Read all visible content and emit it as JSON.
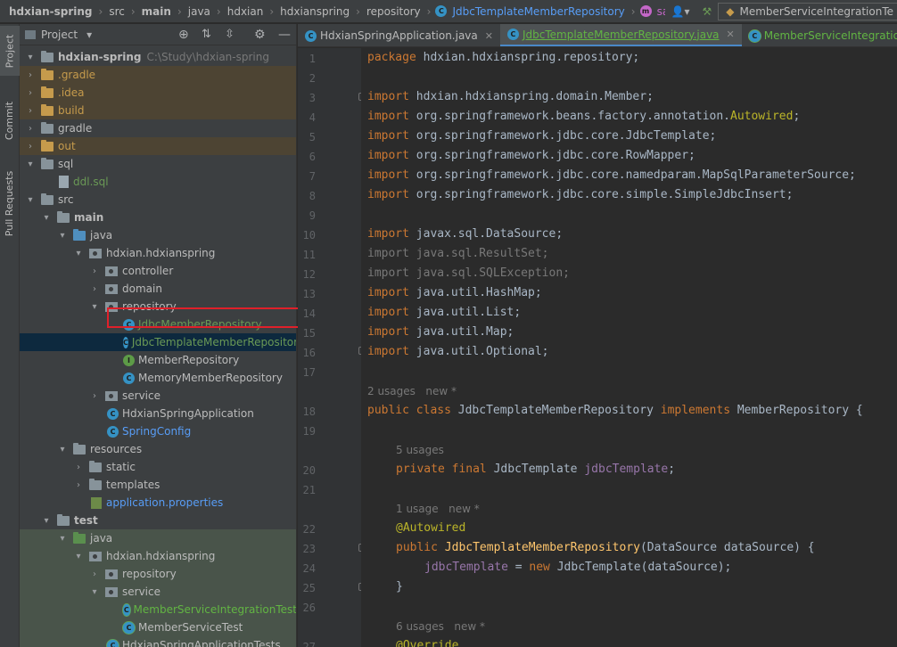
{
  "breadcrumb": {
    "items": [
      "hdxian-spring",
      "src",
      "main",
      "java",
      "hdxian",
      "hdxianspring",
      "repository",
      "JdbcTemplateMemberRepository",
      "save"
    ]
  },
  "toolbar": {
    "run_config": "MemberServiceIntegrationTe"
  },
  "rail": {
    "tabs": [
      "Project",
      "Commit",
      "Pull Requests"
    ]
  },
  "project_panel": {
    "title": "Project",
    "rows": [
      {
        "label": "hdxian-spring",
        "hint": "C:\\Study\\hdxian-spring"
      },
      {
        "label": ".gradle"
      },
      {
        "label": ".idea"
      },
      {
        "label": "build"
      },
      {
        "label": "gradle"
      },
      {
        "label": "out"
      },
      {
        "label": "sql"
      },
      {
        "label": "ddl.sql"
      },
      {
        "label": "src"
      },
      {
        "label": "main"
      },
      {
        "label": "java"
      },
      {
        "label": "hdxian.hdxianspring"
      },
      {
        "label": "controller"
      },
      {
        "label": "domain"
      },
      {
        "label": "repository"
      },
      {
        "label": "JdbcMemberRepository"
      },
      {
        "label": "JdbcTemplateMemberRepository"
      },
      {
        "label": "MemberRepository"
      },
      {
        "label": "MemoryMemberRepository"
      },
      {
        "label": "service"
      },
      {
        "label": "HdxianSpringApplication"
      },
      {
        "label": "SpringConfig"
      },
      {
        "label": "resources"
      },
      {
        "label": "static"
      },
      {
        "label": "templates"
      },
      {
        "label": "application.properties"
      },
      {
        "label": "test"
      },
      {
        "label": "java"
      },
      {
        "label": "hdxian.hdxianspring"
      },
      {
        "label": "repository"
      },
      {
        "label": "service"
      },
      {
        "label": "MemberServiceIntegrationTest"
      },
      {
        "label": "MemberServiceTest"
      },
      {
        "label": "HdxianSpringApplicationTests"
      }
    ]
  },
  "editor_tabs": [
    {
      "label": "HdxianSpringApplication.java"
    },
    {
      "label": "JdbcTemplateMemberRepository.java"
    },
    {
      "label": "MemberServiceIntegrationTest.java"
    }
  ],
  "editor": {
    "line_numbers": [
      "1",
      "2",
      "3",
      "4",
      "5",
      "6",
      "7",
      "8",
      "9",
      "10",
      "11",
      "12",
      "13",
      "14",
      "15",
      "16",
      "17",
      "18",
      "19",
      "20",
      "21",
      "22",
      "23",
      "24",
      "25",
      "26",
      "27"
    ],
    "inlays": [
      "2 usages   new *",
      "5 usages",
      "1 usage   new *",
      "6 usages   new *"
    ],
    "code": [
      {
        "t": "package hdxian.hdxianspring.repository;"
      },
      {
        "t": "import hdxian.hdxianspring.domain.Member;"
      },
      {
        "t": "import org.springframework.beans.factory.annotation.Autowired;"
      },
      {
        "t": "import org.springframework.jdbc.core.JdbcTemplate;"
      },
      {
        "t": "import org.springframework.jdbc.core.RowMapper;"
      },
      {
        "t": "import org.springframework.jdbc.core.namedparam.MapSqlParameterSource;"
      },
      {
        "t": "import org.springframework.jdbc.core.simple.SimpleJdbcInsert;"
      },
      {
        "t": "import javax.sql.DataSource;"
      },
      {
        "t": "import java.sql.ResultSet;"
      },
      {
        "t": "import java.sql.SQLException;"
      },
      {
        "t": "import java.util.HashMap;"
      },
      {
        "t": "import java.util.List;"
      },
      {
        "t": "import java.util.Map;"
      },
      {
        "t": "import java.util.Optional;"
      },
      {
        "t": "public class JdbcTemplateMemberRepository implements MemberRepository {"
      },
      {
        "t": "private final JdbcTemplate jdbcTemplate;"
      },
      {
        "t": "@Autowired"
      },
      {
        "t": "public JdbcTemplateMemberRepository(DataSource dataSource) {"
      },
      {
        "t": "jdbcTemplate = new JdbcTemplate(dataSource);"
      },
      {
        "t": "}"
      },
      {
        "t": "@Override"
      }
    ]
  },
  "colors": {
    "selection": "#0d293e",
    "highlight_box": "#e0202a",
    "keyword": "#cc7832",
    "method": "#ffc66d",
    "field": "#9876aa",
    "annotation": "#bbb529",
    "test_source_bg": "#49544a",
    "excluded_bg": "#4d4433"
  }
}
